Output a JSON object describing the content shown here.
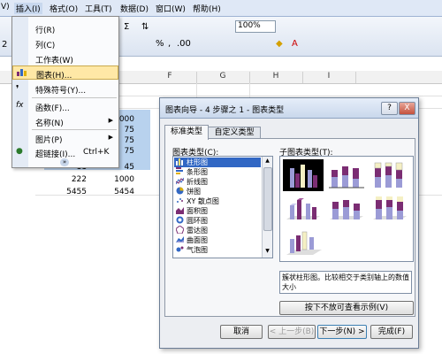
{
  "menubar": {
    "items": [
      "V)",
      "插入(I)",
      "格式(O)",
      "工具(T)",
      "数据(D)",
      "窗口(W)",
      "帮助(H)"
    ]
  },
  "toolbar": {
    "zoom": "100%",
    "sum_symbol": "Σ",
    "comma": ",",
    "percent_group": "%",
    "decimal": ".00"
  },
  "sheet": {
    "col_headers": [
      "F",
      "G",
      "H",
      "I"
    ],
    "name_box_fragment": "2",
    "values": [
      {
        "row": 0,
        "left": "",
        "right": "000"
      },
      {
        "row": 1,
        "left": "",
        "right": "75"
      },
      {
        "row": 2,
        "left": "",
        "right": "75"
      },
      {
        "row": 3,
        "left": "",
        "right": "75"
      },
      {
        "row": 4,
        "left": "11",
        "right": "45"
      },
      {
        "row": 5,
        "left": "222",
        "right": "1000"
      },
      {
        "row": 6,
        "left": "5455",
        "right": "5454"
      }
    ]
  },
  "insert_menu": {
    "items": [
      {
        "label": "行(R)",
        "icon": "row-icon",
        "shortcut": "",
        "submenu": false
      },
      {
        "label": "列(C)",
        "icon": "column-icon",
        "shortcut": "",
        "submenu": false
      },
      {
        "label": "工作表(W)",
        "icon": "sheet-icon",
        "shortcut": "",
        "submenu": false
      },
      {
        "label": "图表(H)...",
        "icon": "chart-icon",
        "shortcut": "",
        "submenu": false
      },
      {
        "label": "特殊符号(Y)...",
        "icon": "symbol-icon",
        "shortcut": "",
        "submenu": false
      },
      {
        "label": "函数(F)...",
        "icon": "function-icon",
        "shortcut": "",
        "submenu": false
      },
      {
        "label": "名称(N)",
        "icon": "name-icon",
        "shortcut": "",
        "submenu": true
      },
      {
        "label": "图片(P)",
        "icon": "picture-icon",
        "shortcut": "",
        "submenu": true
      },
      {
        "label": "超链接(I)...",
        "icon": "hyperlink-icon",
        "shortcut": "Ctrl+K",
        "submenu": false
      }
    ],
    "highlighted_index": 3
  },
  "dialog": {
    "title": "图表向导 - 4 步骤之 1 - 图表类型",
    "help_button": "?",
    "close_button": "X",
    "tabs": [
      "标准类型",
      "自定义类型"
    ],
    "active_tab": 0,
    "chart_types_label": "图表类型(C):",
    "subtypes_label": "子图表类型(T):",
    "chart_types": [
      {
        "label": "柱形图",
        "icon": "column-chart-icon"
      },
      {
        "label": "条形图",
        "icon": "bar-chart-icon"
      },
      {
        "label": "折线图",
        "icon": "line-chart-icon"
      },
      {
        "label": "饼图",
        "icon": "pie-chart-icon"
      },
      {
        "label": "XY 散点图",
        "icon": "scatter-chart-icon"
      },
      {
        "label": "面积图",
        "icon": "area-chart-icon"
      },
      {
        "label": "圆环图",
        "icon": "doughnut-chart-icon"
      },
      {
        "label": "雷达图",
        "icon": "radar-chart-icon"
      },
      {
        "label": "曲面图",
        "icon": "surface-chart-icon"
      },
      {
        "label": "气泡图",
        "icon": "bubble-chart-icon"
      }
    ],
    "selected_type_index": 0,
    "subtype_description": "簇状柱形图。比较相交于类别轴上的数值大小",
    "preview_button": "按下不放可查看示例(V)",
    "buttons": {
      "cancel": "取消",
      "back": "< 上一步(B)",
      "next": "下一步(N) >",
      "finish": "完成(F)"
    },
    "colors": {
      "series_purple": "#7b2d73",
      "series_lavender": "#9b9bd6",
      "series_cream": "#f5f0c4",
      "selected_blue": "#3167c4"
    }
  }
}
